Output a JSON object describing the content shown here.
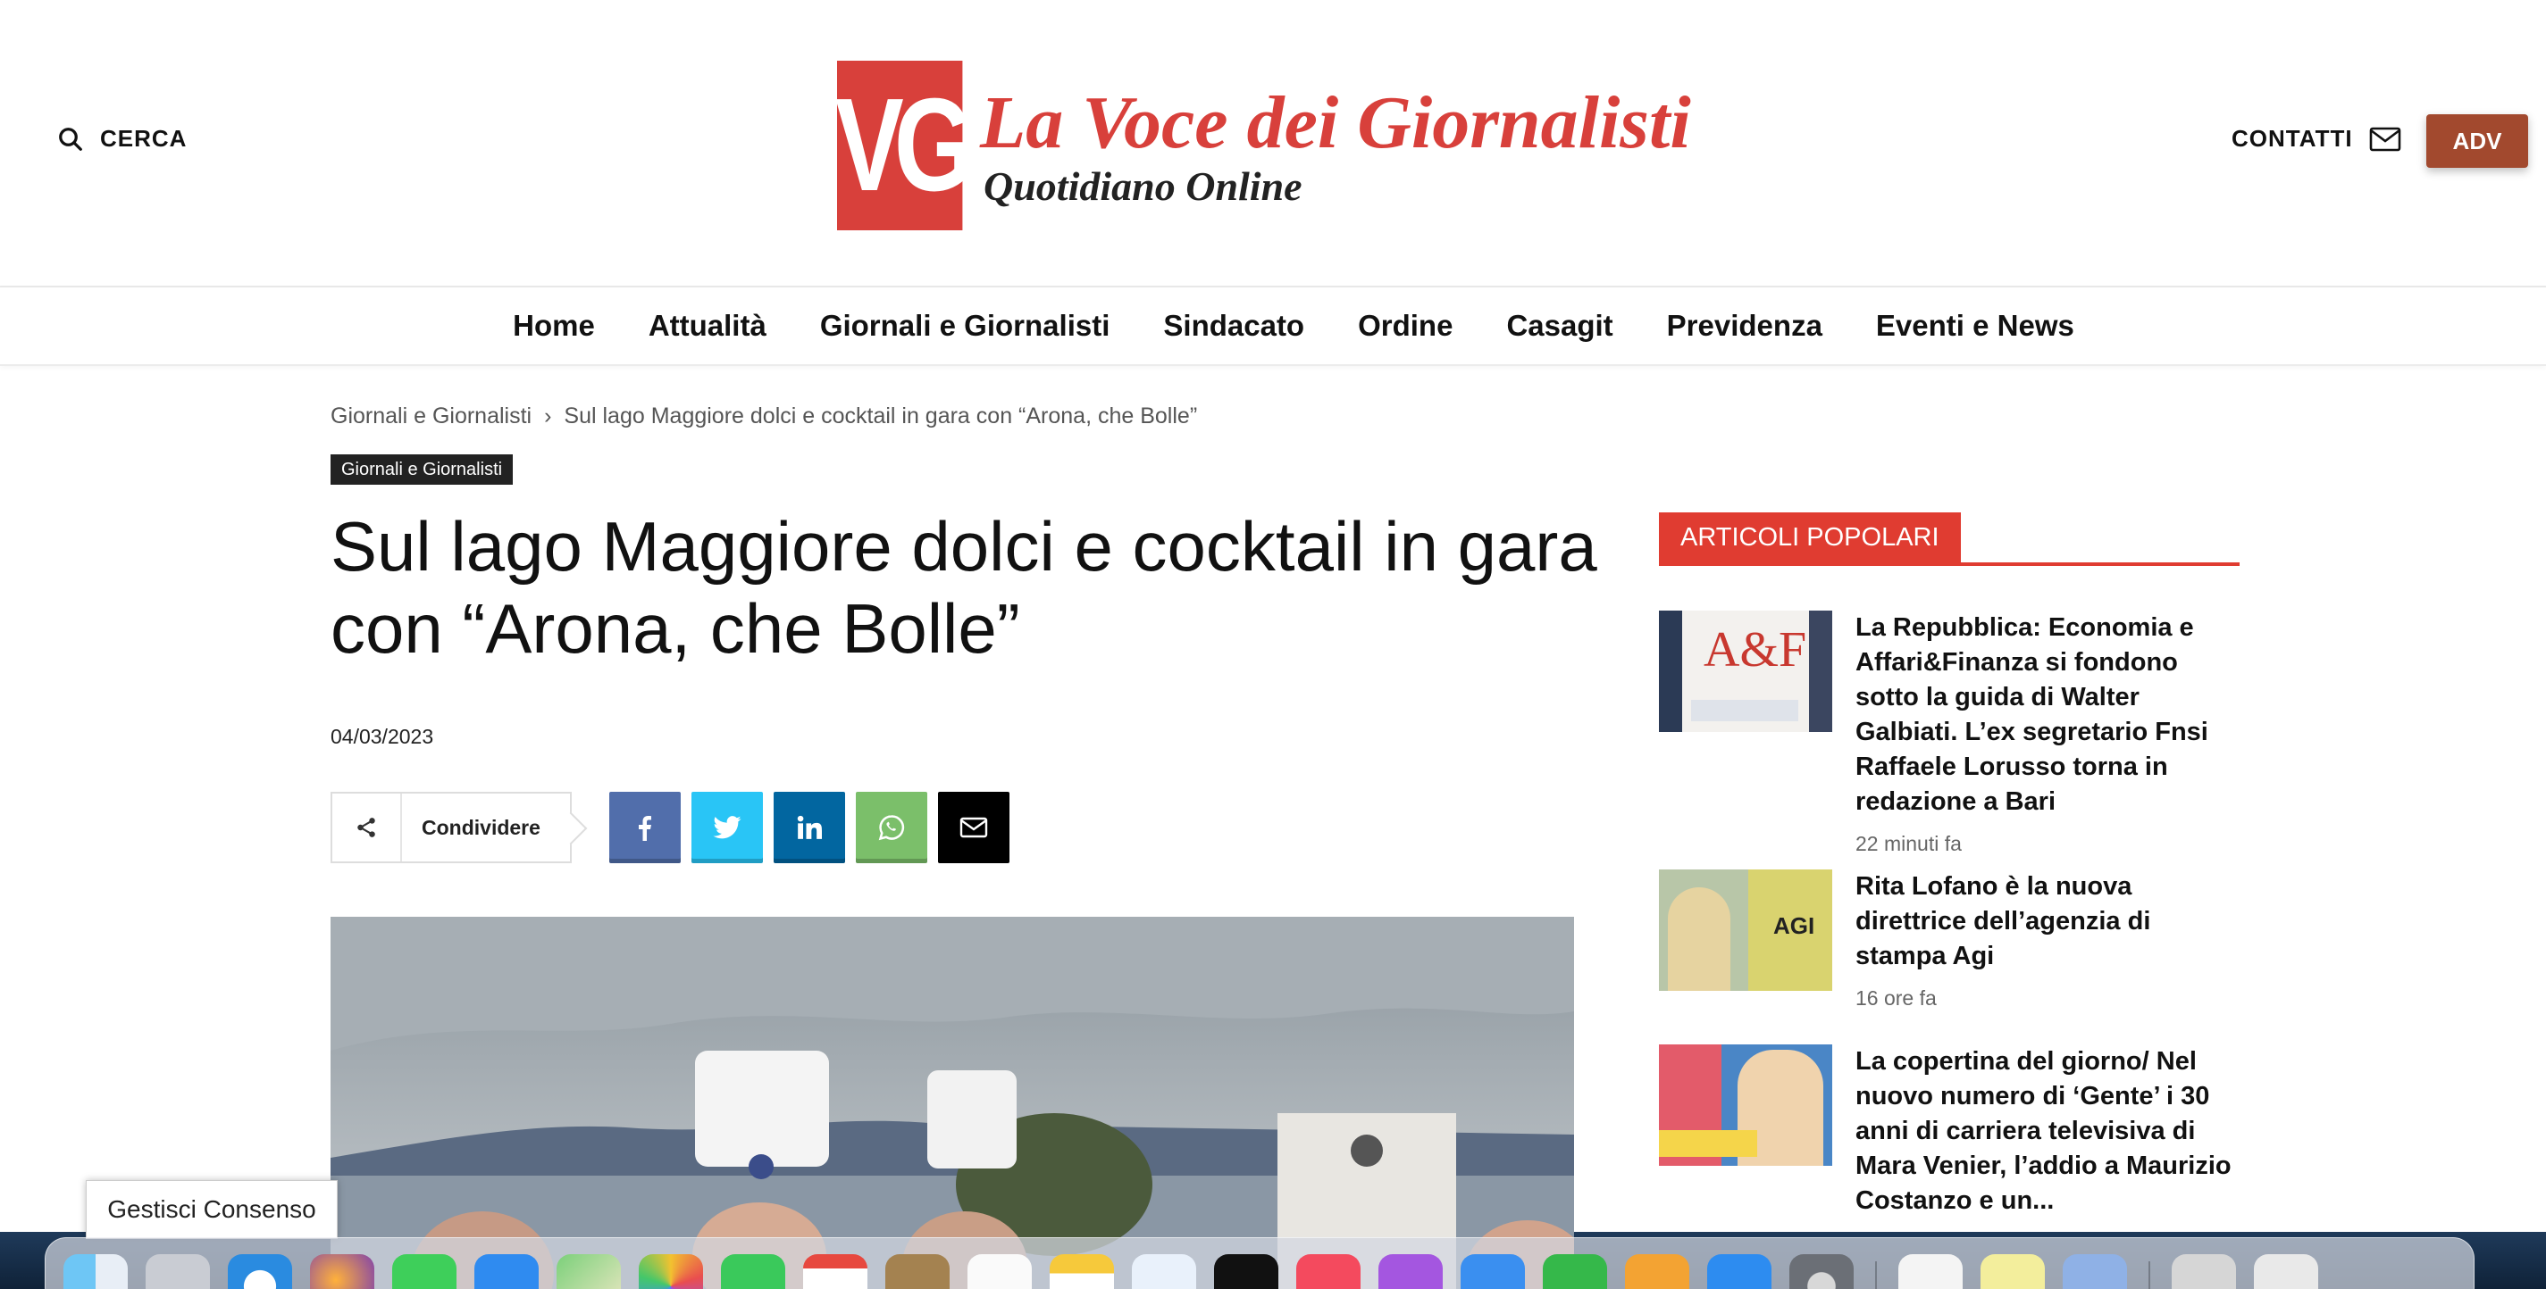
{
  "header": {
    "search_label": "CERCA",
    "logo_mark": "VG",
    "logo_title": "La Voce dei Giornalisti",
    "logo_subtitle": "Quotidiano Online",
    "contacts_label": "CONTATTI",
    "adv_label": "ADV"
  },
  "nav": {
    "items": [
      "Home",
      "Attualità",
      "Giornali e Giornalisti",
      "Sindacato",
      "Ordine",
      "Casagit",
      "Previdenza",
      "Eventi e News"
    ]
  },
  "article": {
    "breadcrumb": [
      "Giornali e Giornalisti",
      "Sul lago Maggiore dolci e cocktail in gara con “Arona, che Bolle”"
    ],
    "breadcrumb_sep": "›",
    "category": "Giornali e Giornalisti",
    "title": "Sul lago Maggiore dolci e cocktail in gara con “Arona, che Bolle”",
    "date": "04/03/2023",
    "share_label": "Condividere"
  },
  "sidebar": {
    "heading": "ARTICOLI POPOLARI",
    "items": [
      {
        "title": "La Repubblica: Economia e Affari&Finanza si fondono sotto la guida di Walter Galbiati. L’ex segretario Fnsi Raffaele Lorusso torna in redazione a Bari",
        "time": "22 minuti fa",
        "thumb_text": "A&F"
      },
      {
        "title": "Rita Lofano è la nuova direttrice dell’agenzia di stampa Agi",
        "time": "16 ore fa",
        "thumb_text": "AGI"
      },
      {
        "title": "La copertina del giorno/ Nel nuovo numero di ‘Gente’ i 30 anni di carriera televisiva di Mara Venier, l’addio a Maurizio Costanzo e un...",
        "time": "",
        "thumb_text": ""
      }
    ]
  },
  "consent": {
    "label": "Gestisci Consenso"
  },
  "colors": {
    "brand_red": "#d8403b",
    "adv": "#a2492e",
    "facebook": "#516eab",
    "twitter": "#29c5f6",
    "linkedin": "#0266a0",
    "whatsapp": "#7bbf6a"
  }
}
